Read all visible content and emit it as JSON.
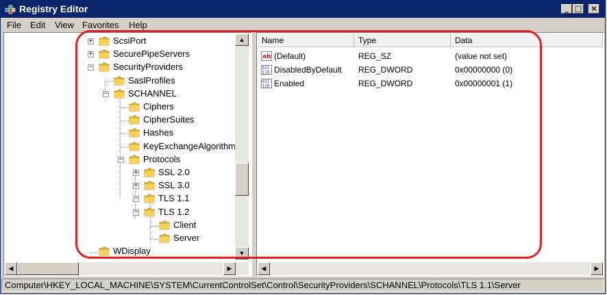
{
  "window": {
    "title": "Registry Editor",
    "buttons": {
      "minimize": "_",
      "maximize": "□",
      "close": "×"
    }
  },
  "menu": [
    "File",
    "Edit",
    "View",
    "Favorites",
    "Help"
  ],
  "tree": [
    {
      "label": "ScsiPort",
      "expander": "+"
    },
    {
      "label": "SecurePipeServers",
      "expander": "+"
    },
    {
      "label": "SecurityProviders",
      "expander": "−"
    },
    {
      "label": "SaslProfiles",
      "expander": ""
    },
    {
      "label": "SCHANNEL",
      "expander": "−"
    },
    {
      "label": "Ciphers",
      "expander": ""
    },
    {
      "label": "CipherSuites",
      "expander": ""
    },
    {
      "label": "Hashes",
      "expander": ""
    },
    {
      "label": "KeyExchangeAlgorithm",
      "expander": ""
    },
    {
      "label": "Protocols",
      "expander": "−"
    },
    {
      "label": "SSL 2.0",
      "expander": "+"
    },
    {
      "label": "SSL 3.0",
      "expander": "+"
    },
    {
      "label": "TLS 1.1",
      "expander": "−"
    },
    {
      "label": "TLS 1.2",
      "expander": "−"
    },
    {
      "label": "Client",
      "expander": ""
    },
    {
      "label": "Server",
      "expander": ""
    },
    {
      "label": "WDisplay",
      "expander": ""
    }
  ],
  "list": {
    "columns": [
      "Name",
      "Type",
      "Data"
    ],
    "rows": [
      {
        "name": "(Default)",
        "type": "REG_SZ",
        "data": "(value not set)",
        "icon": "string-value-icon"
      },
      {
        "name": "DisabledByDefault",
        "type": "REG_DWORD",
        "data": "0x00000000 (0)",
        "icon": "dword-value-icon"
      },
      {
        "name": "Enabled",
        "type": "REG_DWORD",
        "data": "0x00000001 (1)",
        "icon": "dword-value-icon"
      }
    ]
  },
  "status": "Computer\\HKEY_LOCAL_MACHINE\\SYSTEM\\CurrentControlSet\\Control\\SecurityProviders\\SCHANNEL\\Protocols\\TLS 1.1\\Server",
  "colors": {
    "titlebar": "#0a246a",
    "annotation": "#e02020",
    "folder": "#e8b830"
  }
}
